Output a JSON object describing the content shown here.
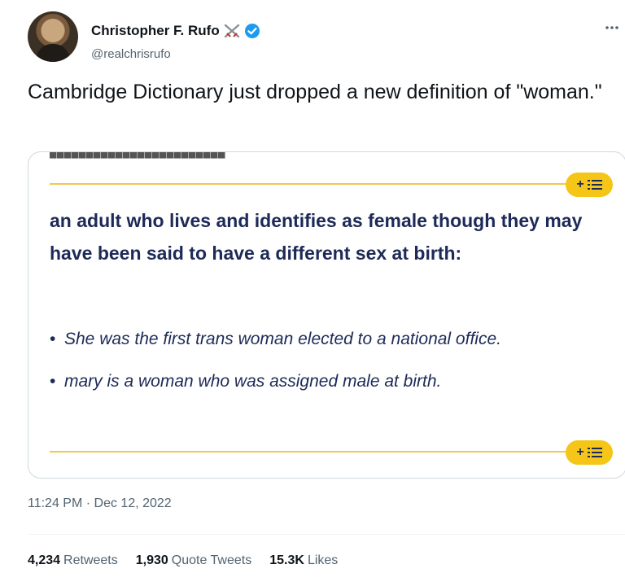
{
  "author": {
    "name": "Christopher F. Rufo",
    "handle": "@realchrisrufo",
    "verified": true,
    "badge_icons": [
      "crossed-swords-icon",
      "verified-icon"
    ]
  },
  "tweet": {
    "text": "Cambridge Dictionary just dropped a new definition of \"woman.\"",
    "timestamp": "11:24 PM · Dec 12, 2022"
  },
  "media": {
    "definition": "an adult who lives and identifies as female though they may have been said to have a different sex at birth:",
    "examples": [
      "She was the first trans woman elected to a national office.",
      "mary is a woman who was assigned male at birth."
    ],
    "bullet": "•",
    "plus_label": "+",
    "accent_color": "#f5c518",
    "text_color": "#1d2a57"
  },
  "stats": {
    "retweets": {
      "count": "4,234",
      "label": "Retweets"
    },
    "quote_tweets": {
      "count": "1,930",
      "label": "Quote Tweets"
    },
    "likes": {
      "count": "15.3K",
      "label": "Likes"
    }
  }
}
